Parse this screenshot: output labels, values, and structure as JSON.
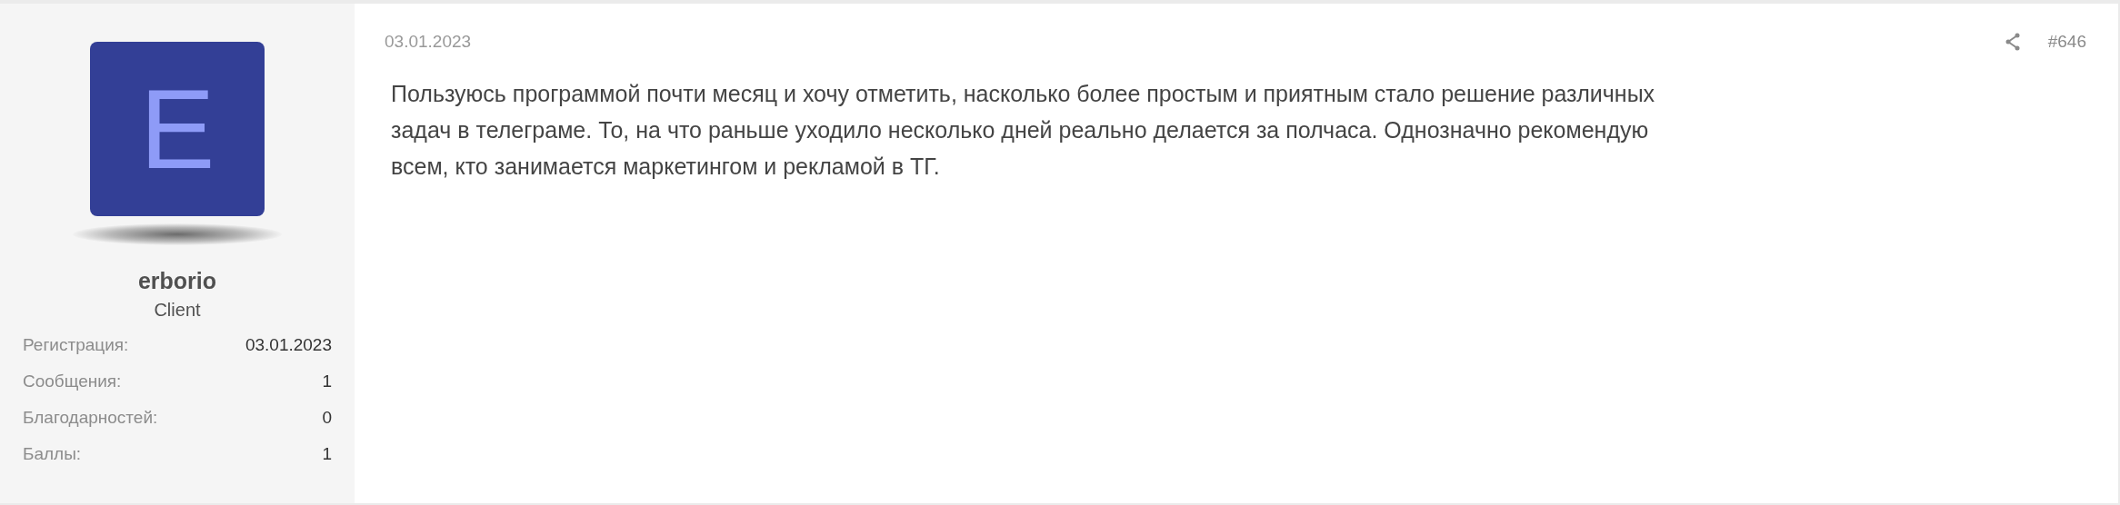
{
  "user": {
    "avatar_letter": "E",
    "name": "erborio",
    "title": "Client",
    "stats": [
      {
        "label": "Регистрация:",
        "value": "03.01.2023"
      },
      {
        "label": "Сообщения:",
        "value": "1"
      },
      {
        "label": "Благодарностей:",
        "value": "0"
      },
      {
        "label": "Баллы:",
        "value": "1"
      }
    ]
  },
  "post": {
    "date": "03.01.2023",
    "number": "#646",
    "text": "Пользуюсь программой почти месяц и хочу отметить, насколько более простым и приятным стало решение различных задач в телеграме. То, на что раньше уходило несколько дней реально делается за полчаса. Однозначно рекомендую всем, кто занимается маркетингом и рекламой в ТГ."
  }
}
